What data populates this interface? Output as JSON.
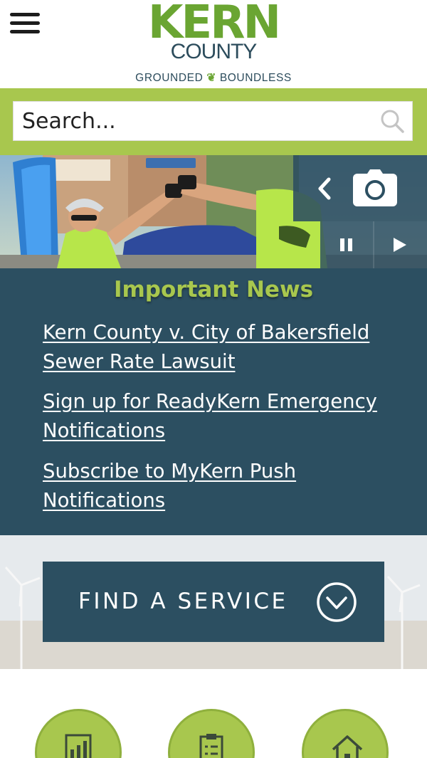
{
  "header": {
    "logo_line1": "KERN",
    "logo_line2": "COUNTY",
    "tagline_left": "GROUNDED",
    "tagline_right": "BOUNDLESS",
    "menu_icon": "hamburger-menu-icon"
  },
  "search": {
    "placeholder": "Search...",
    "icon": "search-icon"
  },
  "hero": {
    "controls": [
      "previous-icon",
      "camera-icon",
      "pause-icon",
      "play-icon"
    ]
  },
  "news": {
    "title": "Important News",
    "links": [
      {
        "line1": "Kern County v. City of Bakersfield",
        "line2": "Sewer Rate Lawsuit"
      },
      {
        "line1": "Sign up for ReadyKern Emergency",
        "line2": "Notifications"
      },
      {
        "line1": "Subscribe to MyKern Push",
        "line2": "Notifications"
      }
    ]
  },
  "service": {
    "label": "FIND A SERVICE",
    "icon": "chevron-down-circle-icon"
  },
  "quick_links": {
    "icons": [
      "chart-report-icon",
      "clipboard-list-icon",
      "home-icon"
    ]
  },
  "colors": {
    "brand_green": "#a8c74e",
    "logo_green": "#6aa532",
    "brand_navy": "#2c4f61"
  }
}
